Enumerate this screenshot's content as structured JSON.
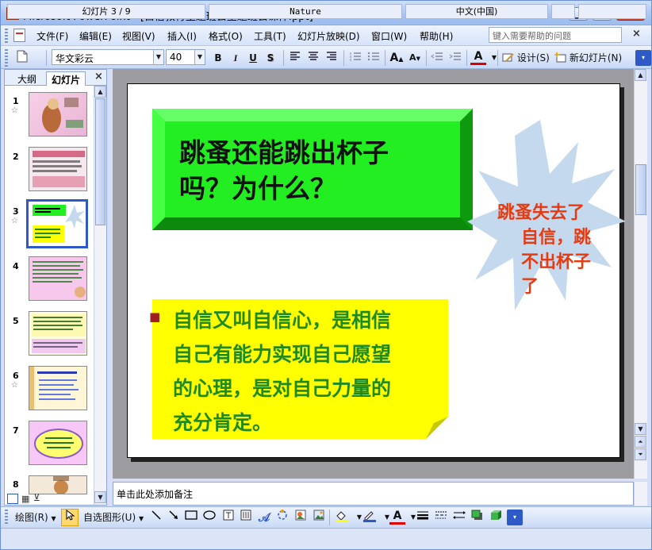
{
  "window": {
    "app_name": "Microsoft PowerPoint",
    "title": "Microsoft PowerPoint - [自信教育主题班会主题班会课件.ppt]",
    "app_icon": "P",
    "minimize_glyph": "▁",
    "maximize_glyph": "▭",
    "close_glyph": "✕"
  },
  "menubar": {
    "items": [
      "文件(F)",
      "编辑(E)",
      "视图(V)",
      "插入(I)",
      "格式(O)",
      "工具(T)",
      "幻灯片放映(D)",
      "窗口(W)",
      "帮助(H)"
    ],
    "help_placeholder": "键入需要帮助的问题",
    "close_doc": "×"
  },
  "toolbar": {
    "font_name": "华文彩云",
    "font_size": "40",
    "bold": "B",
    "italic": "I",
    "underline": "U",
    "shadow": "S",
    "design": "设计(S)",
    "new_slide": "新幻灯片(N)",
    "font_color_glyph": "A"
  },
  "slide_panel": {
    "tab_outline": "大纲",
    "tab_slides": "幻灯片",
    "close": "×",
    "slide_numbers": [
      "1",
      "2",
      "3",
      "4",
      "5",
      "6",
      "7",
      "8"
    ],
    "star": "☆",
    "selected_index": 3
  },
  "slide": {
    "title": "跳蚤还能跳出杯子吗？为什么？",
    "title_line1": "跳蚤还能跳出杯子",
    "title_line2": "吗？为什么？",
    "starburst_lines": [
      "跳蚤失去了",
      "自信，跳",
      "不出杯子",
      "了"
    ],
    "bullet": "■",
    "body_lines": [
      "自信又叫自信心，是相信",
      "自己有能力实现自己愿望",
      "的心理，是对自己力量的",
      "充分肯定。"
    ],
    "colors": {
      "title_box": "#22ee22",
      "title_bevel_dark": "#11aa11",
      "starburst": "#c5d9ee",
      "starburst_text": "#e83a10",
      "body_box": "#ffff00",
      "body_text": "#1f8a1f",
      "bullet": "#a02020"
    }
  },
  "notes": {
    "placeholder": "单击此处添加备注"
  },
  "drawbar": {
    "draw_label": "绘图(R)",
    "autoshapes_label": "自选图形(U)"
  },
  "status": {
    "slide": "幻灯片 3 / 9",
    "design": "Nature",
    "language": "中文(中国)"
  }
}
